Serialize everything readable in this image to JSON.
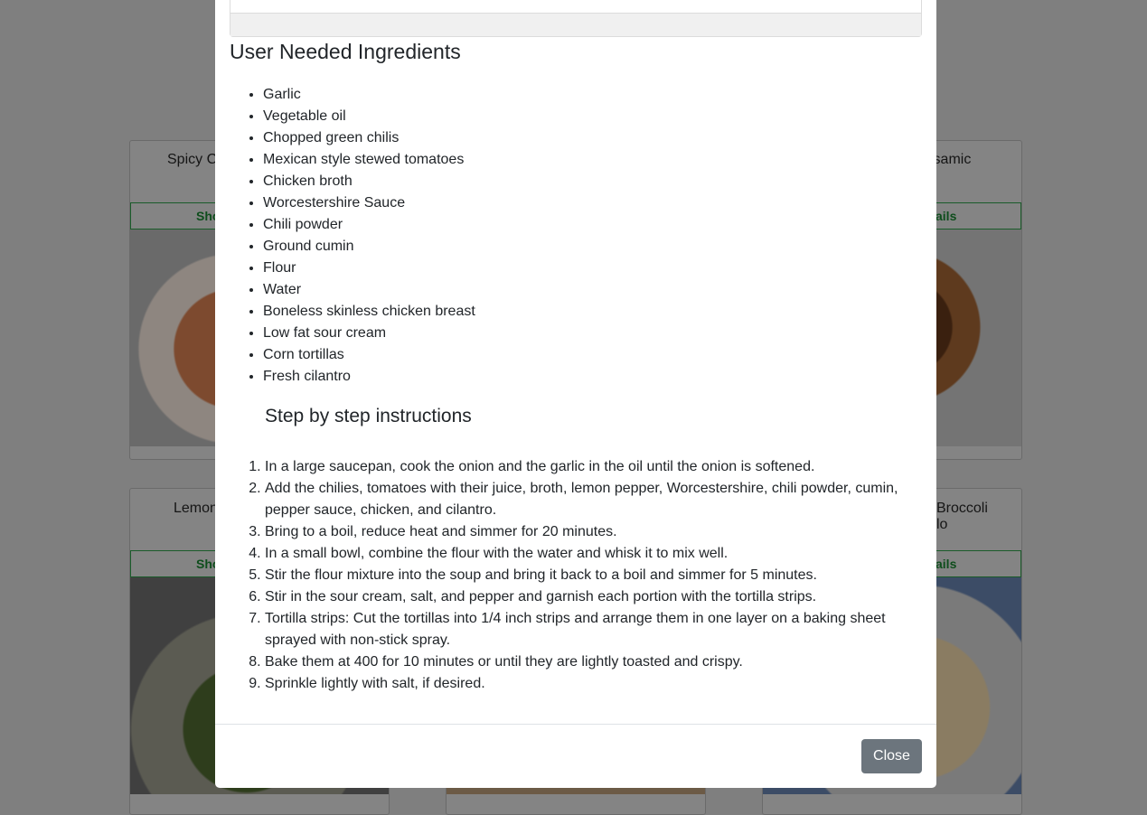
{
  "background": {
    "cards": [
      {
        "title": "Spicy C",
        "button": "Sho"
      },
      {
        "title": "lsamic",
        "button": "ails"
      },
      {
        "title": "Lemon",
        "button": "Sho"
      },
      {
        "title": "Broccoli\nlo",
        "button": "ails"
      }
    ]
  },
  "modal": {
    "ingredients_heading": "User Needed Ingredients",
    "ingredients": [
      "Garlic",
      "Vegetable oil",
      "Chopped green chilis",
      "Mexican style stewed tomatoes",
      "Chicken broth",
      "Worcestershire Sauce",
      "Chili powder",
      "Ground cumin",
      "Flour",
      "Water",
      "Boneless skinless chicken breast",
      "Low fat sour cream",
      "Corn tortillas",
      "Fresh cilantro"
    ],
    "instructions_heading": "Step by step instructions",
    "steps": [
      "In a large saucepan, cook the onion and the garlic in the oil until the onion is softened.",
      "Add the chilies, tomatoes with their juice, broth, lemon pepper, Worcestershire, chili powder, cumin, pepper sauce, chicken, and cilantro.",
      "Bring to a boil, reduce heat and simmer for 20 minutes.",
      "In a small bowl, combine the flour with the water and whisk it to mix well.",
      "Stir the flour mixture into the soup and bring it back to a boil and simmer for 5 minutes.",
      "Stir in the sour cream, salt, and pepper and garnish each portion with the tortilla strips.",
      "Tortilla strips: Cut the tortillas into 1/4 inch strips and arrange them in one layer on a baking sheet sprayed with non-stick spray.",
      "Bake them at 400 for 10 minutes or until they are lightly toasted and crispy.",
      "Sprinkle lightly with salt, if desired."
    ],
    "close_label": "Close"
  }
}
